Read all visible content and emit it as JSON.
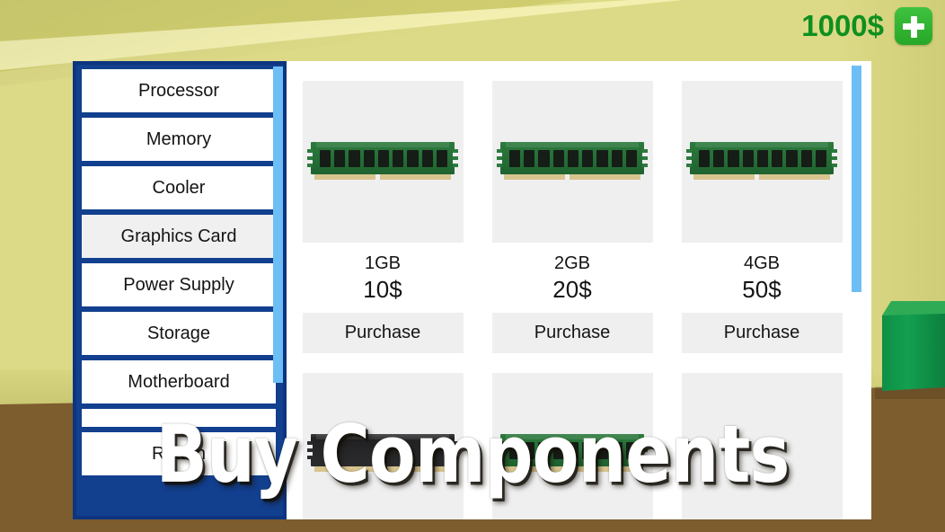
{
  "hud": {
    "money": "1000$",
    "add_money_icon": "plus-icon"
  },
  "title": "Buy Components",
  "sidebar": {
    "items": [
      {
        "label": "Processor",
        "state": "normal"
      },
      {
        "label": "Memory",
        "state": "normal"
      },
      {
        "label": "Cooler",
        "state": "normal"
      },
      {
        "label": "Graphics Card",
        "state": "hovered"
      },
      {
        "label": "Power Supply",
        "state": "normal"
      },
      {
        "label": "Storage",
        "state": "normal"
      },
      {
        "label": "Motherboard",
        "state": "normal"
      },
      {
        "label": "",
        "state": "blank"
      },
      {
        "label": "Return",
        "state": "normal"
      }
    ]
  },
  "shop": {
    "category": "Memory",
    "purchase_label": "Purchase",
    "products": [
      {
        "name": "1GB",
        "price": "10$",
        "image": "ram-module-green"
      },
      {
        "name": "2GB",
        "price": "20$",
        "image": "ram-module-green"
      },
      {
        "name": "4GB",
        "price": "50$",
        "image": "ram-module-green"
      },
      {
        "name": "",
        "price": "",
        "image": "ram-module-black"
      },
      {
        "name": "",
        "price": "",
        "image": "ram-module-green"
      },
      {
        "name": "",
        "price": "",
        "image": "ram-module-none"
      }
    ]
  },
  "colors": {
    "sidebar_blue": "#123f8e",
    "scrollbar_blue": "#6dbef5",
    "money_green": "#0f8f1f",
    "wall": "#dcda86",
    "floor": "#7d5c2e",
    "desk_green": "#12a04f",
    "card_gray": "#efefef"
  }
}
